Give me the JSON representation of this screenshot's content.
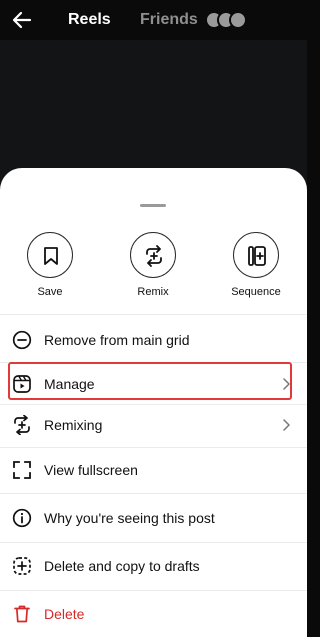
{
  "header": {
    "tabs": [
      {
        "label": "Reels",
        "active": true
      },
      {
        "label": "Friends",
        "active": false
      }
    ]
  },
  "quick_actions": [
    {
      "label": "Save",
      "icon": "bookmark-icon"
    },
    {
      "label": "Remix",
      "icon": "remix-icon"
    },
    {
      "label": "Sequence",
      "icon": "sequence-icon"
    }
  ],
  "menu": [
    {
      "label": "Remove from main grid",
      "icon": "remove-circle-icon"
    },
    {
      "label": "Manage",
      "icon": "reel-manage-icon",
      "chevron": true,
      "highlighted": true
    },
    {
      "label": "Remixing",
      "icon": "remix-icon",
      "chevron": true
    },
    {
      "label": "View fullscreen",
      "icon": "fullscreen-icon"
    },
    {
      "label": "Why you're seeing this post",
      "icon": "info-icon"
    },
    {
      "label": "Delete and copy to drafts",
      "icon": "dashed-plus-icon"
    },
    {
      "label": "Delete",
      "icon": "trash-icon",
      "destructive": true
    }
  ],
  "colors": {
    "highlight_border": "#e03a3a",
    "destructive": "#d62a2a",
    "background_dark": "#0a0a0a"
  }
}
